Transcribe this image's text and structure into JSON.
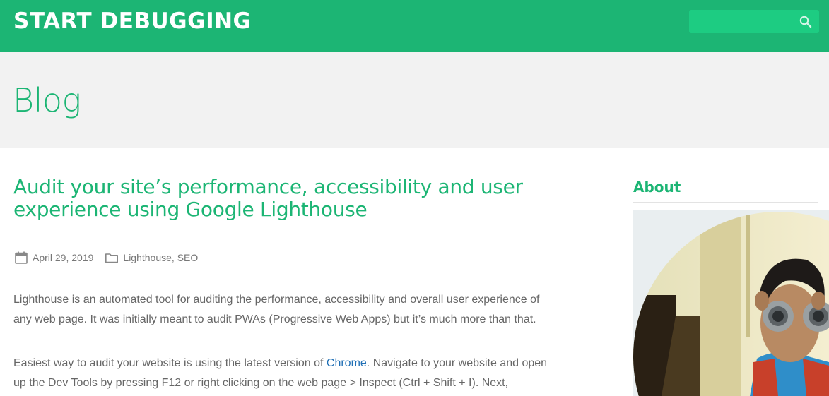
{
  "header": {
    "site_title": "START DEBUGGING",
    "search": {
      "placeholder": "",
      "value": ""
    },
    "colors": {
      "bar": "#1cb574",
      "search_bg": "#1dcc82"
    }
  },
  "page": {
    "title": "Blog"
  },
  "post": {
    "title": "Audit your site’s performance, accessibility and user experience using Google Lighthouse",
    "date": "April 29, 2019",
    "categories": "Lighthouse, SEO",
    "paragraph1": "Lighthouse is an automated tool for auditing the performance, accessibility and overall user experience of any web page. It was initially meant to audit PWAs (Progressive Web Apps) but it’s much more than that.",
    "paragraph2_before_link": "Easiest way to audit your website is using the latest version of ",
    "paragraph2_link": "Chrome",
    "paragraph2_after_link": ". Navigate to your website and open up the Dev Tools by pressing F12 or right clicking on the web page > Inspect (Ctrl + Shift + I). Next,",
    "icons": {
      "date": "calendar-icon",
      "categories": "folder-icon"
    }
  },
  "sidebar": {
    "heading": "About",
    "image": "profile-photo"
  },
  "accent_color": "#1cb574",
  "link_color": "#1f6fb5"
}
